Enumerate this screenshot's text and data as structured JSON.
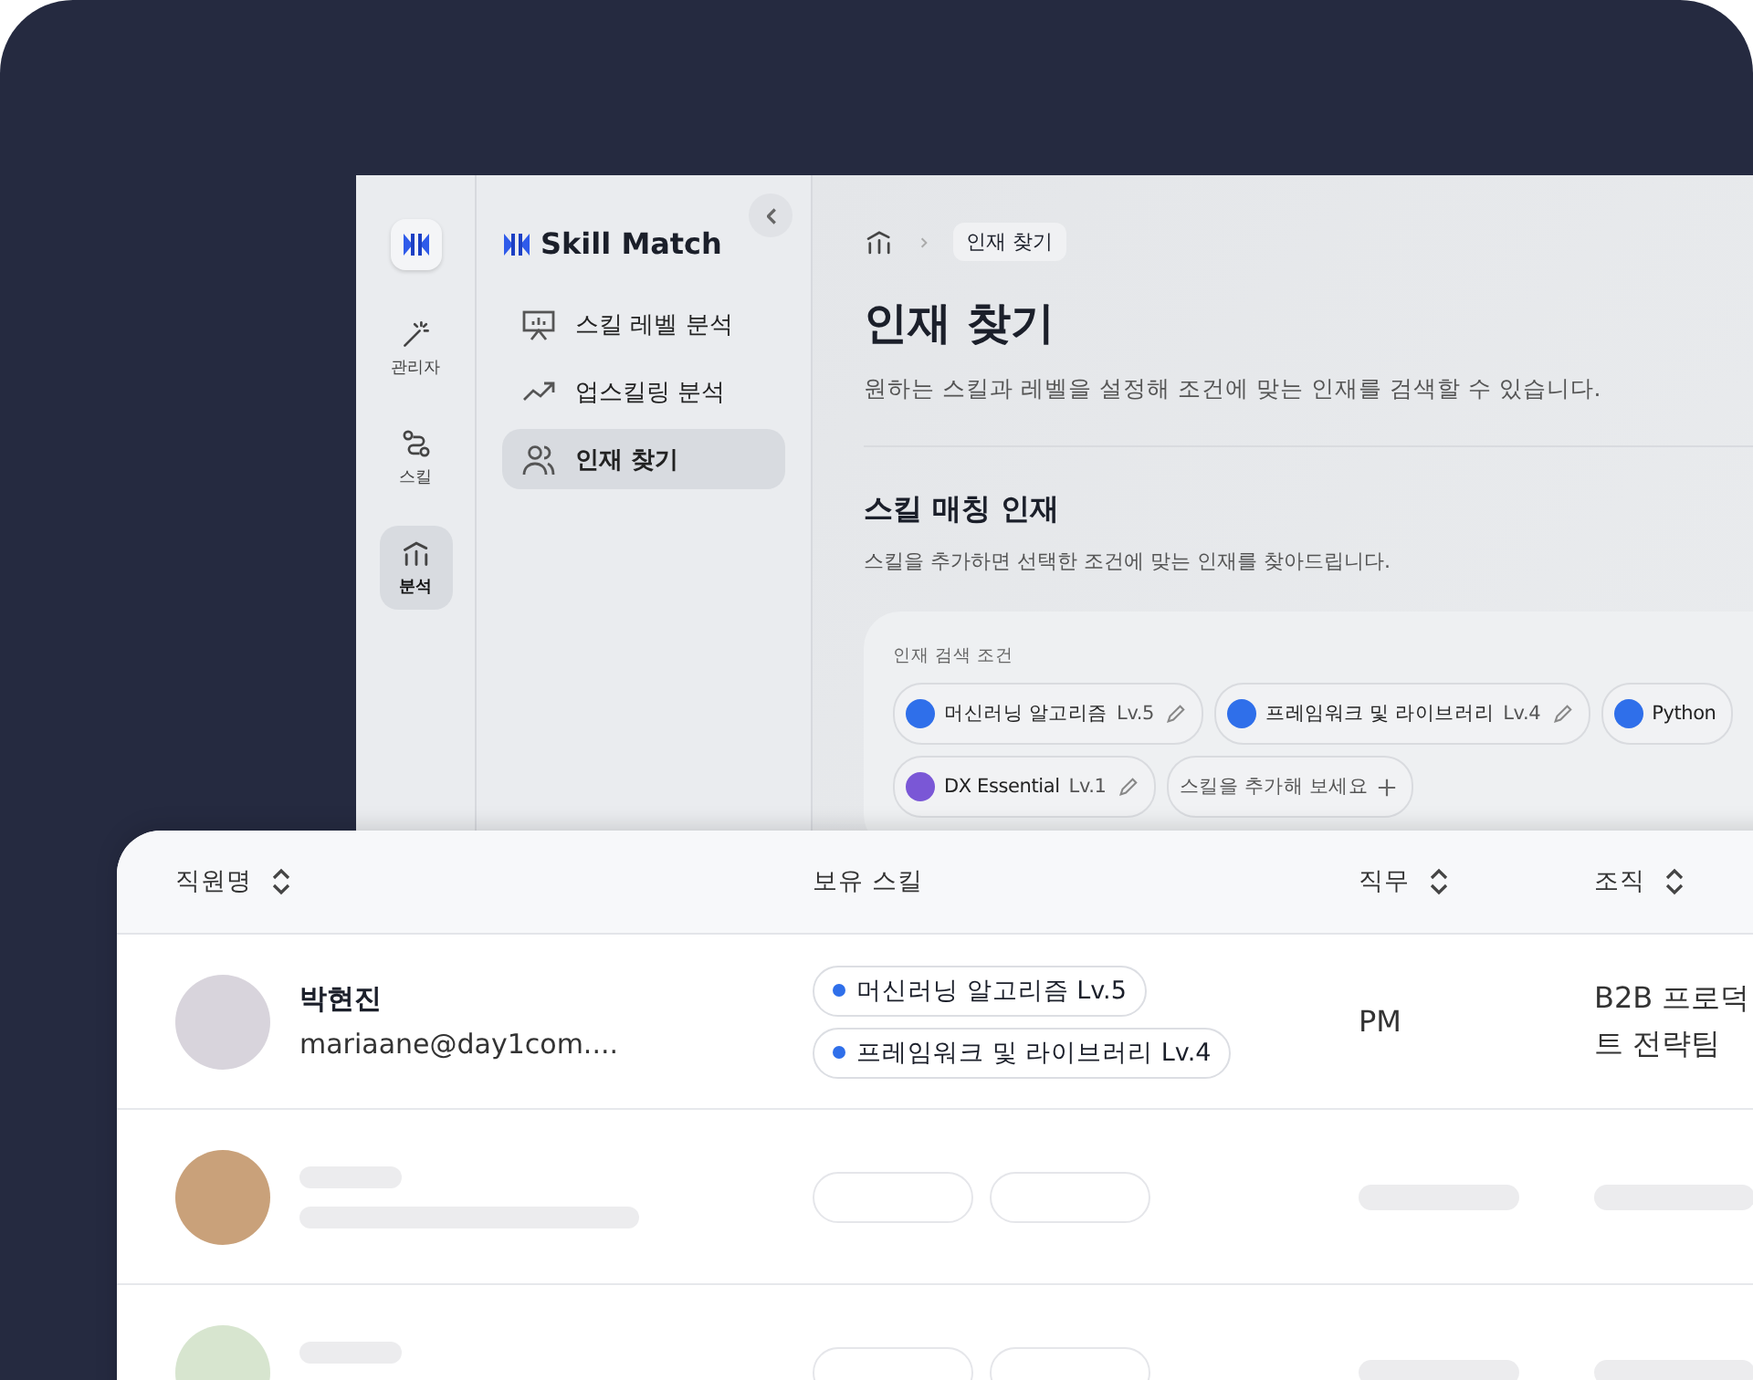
{
  "rail": {
    "items": [
      {
        "label": "관리자",
        "selected": false
      },
      {
        "label": "스킬",
        "selected": false
      },
      {
        "label": "분석",
        "selected": true
      }
    ]
  },
  "nav": {
    "brand": "Skill Match",
    "items": [
      {
        "label": "스킬 레벨 분석",
        "selected": false
      },
      {
        "label": "업스킬링 분석",
        "selected": false
      },
      {
        "label": "인재 찾기",
        "selected": true
      }
    ]
  },
  "breadcrumb": {
    "current": "인재 찾기"
  },
  "page": {
    "title": "인재 찾기",
    "description": "원하는 스킬과 레벨을 설정해 조건에 맞는 인재를 검색할 수 있습니다."
  },
  "section": {
    "title": "스킬 매칭 인재",
    "description": "스킬을 추가하면 선택한 조건에 맞는 인재를 찾아드립니다.",
    "filter_label": "인재 검색 조건",
    "chips": [
      {
        "name": "머신러닝 알고리즘",
        "level": "Lv.5",
        "color": "#2f6fea"
      },
      {
        "name": "프레임워크 및 라이브러리",
        "level": "Lv.4",
        "color": "#2f6fea"
      },
      {
        "name": "Python",
        "color": "#2f6fea"
      },
      {
        "name": "DX Essential",
        "level": "Lv.1",
        "color": "#7a57d6"
      }
    ],
    "add_chip": "스킬을 추가해 보세요"
  },
  "table": {
    "columns": [
      {
        "label": "직원명",
        "sortable": true
      },
      {
        "label": "보유 스킬",
        "sortable": false
      },
      {
        "label": "직무",
        "sortable": true
      },
      {
        "label": "조직",
        "sortable": true
      }
    ],
    "rows": [
      {
        "kind": "person",
        "name": "박현진",
        "email": "mariaane@day1com....",
        "skills": [
          "머신러닝 알고리즘 Lv.5",
          "프레임워크 및 라이브러리 Lv.4"
        ],
        "role": "PM",
        "org": "B2B 프로덕트 전략팀"
      },
      {
        "kind": "placeholder"
      },
      {
        "kind": "placeholder"
      }
    ]
  }
}
